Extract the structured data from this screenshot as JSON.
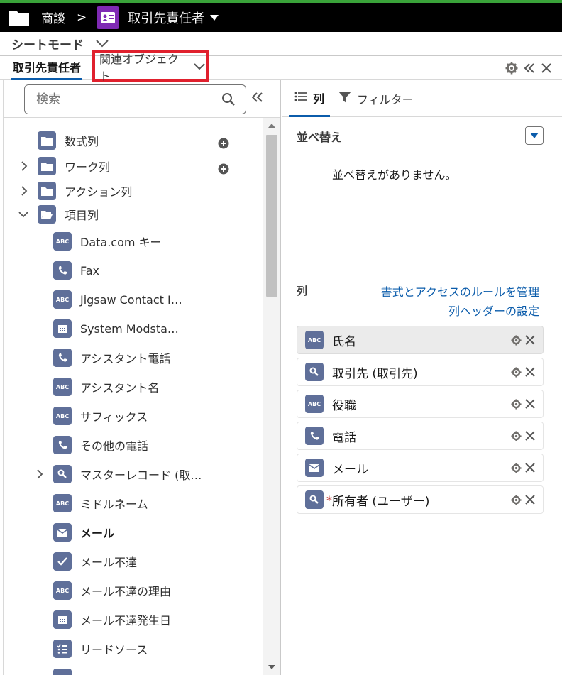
{
  "topbar": {
    "breadcrumb": "商談",
    "separator": ">",
    "object_label": "取引先責任者"
  },
  "sheet_mode": {
    "label": "シートモード"
  },
  "tabs": {
    "active": "取引先責任者",
    "related": "関連オブジェクト"
  },
  "search": {
    "placeholder": "検索"
  },
  "tree": {
    "groups": [
      {
        "label": "数式列"
      },
      {
        "label": "ワーク列"
      },
      {
        "label": "アクション列"
      },
      {
        "label": "項目列"
      }
    ],
    "fields": [
      {
        "label": "Data.com キー",
        "icon": "abc-icon"
      },
      {
        "label": "Fax",
        "icon": "phone-icon"
      },
      {
        "label": "Jigsaw Contact I…",
        "icon": "abc-icon"
      },
      {
        "label": "System Modsta…",
        "icon": "calendar-icon"
      },
      {
        "label": "アシスタント電話",
        "icon": "phone-icon"
      },
      {
        "label": "アシスタント名",
        "icon": "abc-icon"
      },
      {
        "label": "サフィックス",
        "icon": "abc-icon"
      },
      {
        "label": "その他の電話",
        "icon": "phone-icon"
      },
      {
        "label": "マスターレコード (取…",
        "icon": "lookup-icon"
      },
      {
        "label": "ミドルネーム",
        "icon": "abc-icon"
      },
      {
        "label": "メール",
        "icon": "email-icon"
      },
      {
        "label": "メール不達",
        "icon": "checkbox-icon"
      },
      {
        "label": "メール不達の理由",
        "icon": "abc-icon"
      },
      {
        "label": "メール不達発生日",
        "icon": "calendar-icon"
      },
      {
        "label": "リードソース",
        "icon": "picklist-icon"
      }
    ]
  },
  "right": {
    "tabs": {
      "columns": "列",
      "filter": "フィルター"
    },
    "sort": {
      "title": "並べ替え",
      "empty": "並べ替えがありません。"
    },
    "columns": {
      "title": "列",
      "link_rules": "書式とアクセスのルールを管理",
      "link_header": "列ヘッダーの設定",
      "items": [
        {
          "label": "氏名",
          "icon": "abc-icon"
        },
        {
          "label": "取引先 (取引先)",
          "icon": "lookup-icon"
        },
        {
          "label": "役職",
          "icon": "abc-icon"
        },
        {
          "label": "電話",
          "icon": "phone-icon"
        },
        {
          "label": "メール",
          "icon": "email-icon"
        },
        {
          "label": "所有者 (ユーザー)",
          "icon": "lookup-icon",
          "required": "*"
        }
      ]
    }
  },
  "icon_text": {
    "abc": "ABC"
  },
  "colors": {
    "accent": "#0b5cab",
    "icon_bg": "#5f6f99",
    "object_icon": "#7f2ab4",
    "highlight_box": "#e0202d"
  }
}
